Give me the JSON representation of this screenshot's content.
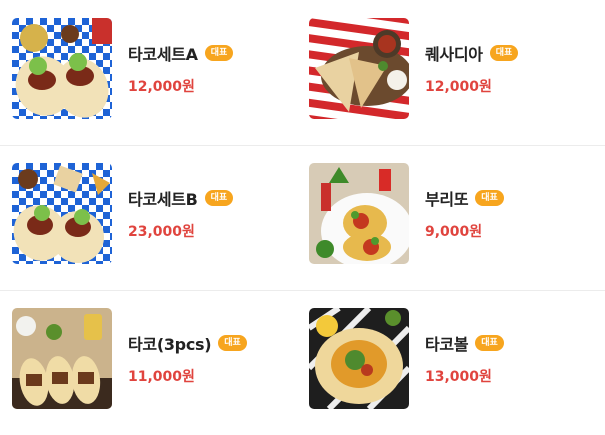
{
  "menu": {
    "items": [
      {
        "name": "타코세트A",
        "badge": "대표",
        "price": "12,000원"
      },
      {
        "name": "퀘사디아",
        "badge": "대표",
        "price": "12,000원"
      },
      {
        "name": "타코세트B",
        "badge": "대표",
        "price": "23,000원"
      },
      {
        "name": "부리또",
        "badge": "대표",
        "price": "9,000원"
      },
      {
        "name": "타코(3pcs)",
        "badge": "대표",
        "price": "11,000원"
      },
      {
        "name": "타코볼",
        "badge": "대표",
        "price": "13,000원"
      }
    ]
  },
  "colors": {
    "accent_badge": "#f7a51e",
    "price": "#e0443e",
    "title": "#222222"
  }
}
